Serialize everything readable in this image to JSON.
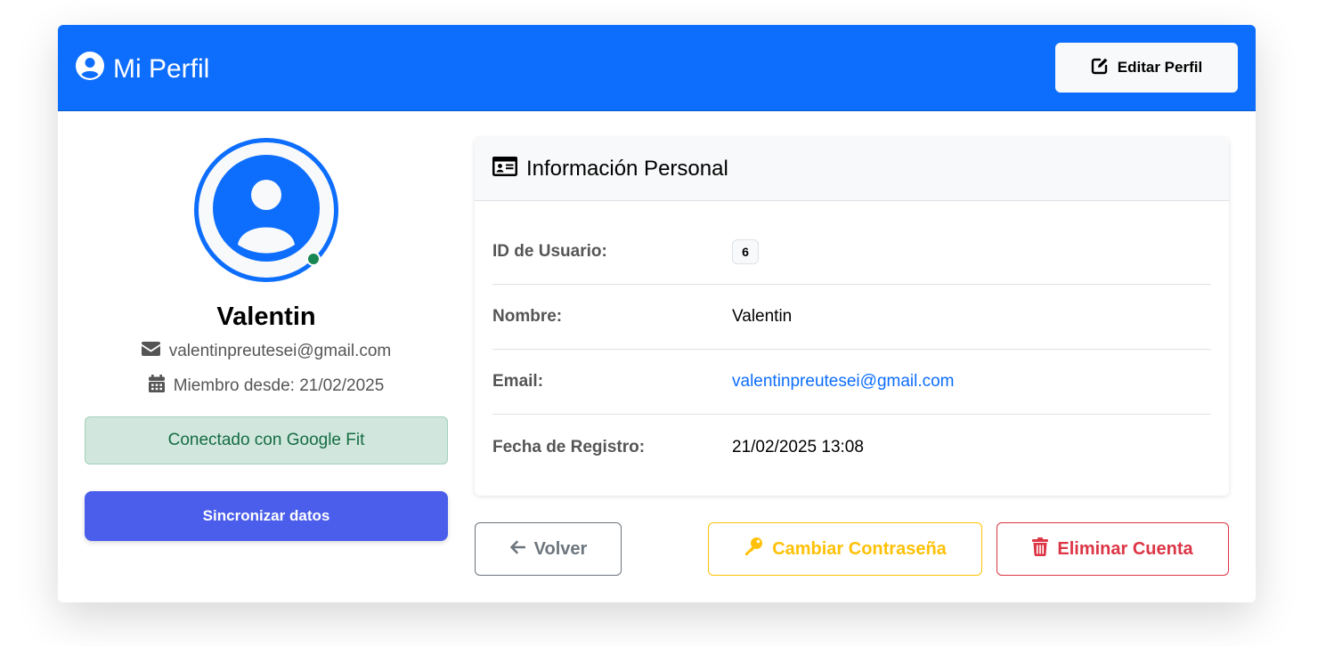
{
  "header": {
    "title": "Mi Perfil",
    "edit_button": "Editar Perfil"
  },
  "profile": {
    "name": "Valentin",
    "email": "valentinpreutesei@gmail.com",
    "member_since": "Miembro desde: 21/02/2025",
    "google_fit_status": "Conectado con Google Fit",
    "sync_button": "Sincronizar datos",
    "online_status_color": "#198754"
  },
  "info": {
    "title": "Información Personal",
    "rows": [
      {
        "label": "ID de Usuario:",
        "value": "6"
      },
      {
        "label": "Nombre:",
        "value": "Valentin"
      },
      {
        "label": "Email:",
        "value": "valentinpreutesei@gmail.com"
      },
      {
        "label": "Fecha de Registro:",
        "value": "21/02/2025 13:08"
      }
    ]
  },
  "actions": {
    "back": "Volver",
    "change_password": "Cambiar Contraseña",
    "delete_account": "Eliminar Cuenta"
  },
  "colors": {
    "primary": "#0d6efd",
    "sync": "#4a5eeb",
    "success_bg": "#d1e7dd",
    "warning": "#ffc107",
    "danger": "#dc3545",
    "secondary": "#6c757d"
  },
  "icons": {
    "header": "user-circle-icon",
    "edit": "edit-icon",
    "email": "envelope-icon",
    "calendar": "calendar-icon",
    "id_card": "id-card-icon",
    "back": "arrow-left-icon",
    "key": "key-icon",
    "trash": "trash-icon"
  }
}
